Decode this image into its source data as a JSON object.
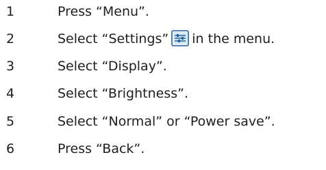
{
  "steps": [
    {
      "number": "1",
      "text": "Press “Menu”."
    },
    {
      "number": "2",
      "text_before": "Select “Settings”",
      "icon": "settings-icon",
      "text_after": "in the menu."
    },
    {
      "number": "3",
      "text": "Select “Display”."
    },
    {
      "number": "4",
      "text": "Select “Brightness”."
    },
    {
      "number": "5",
      "text": "Select “Normal” or “Power save”."
    },
    {
      "number": "6",
      "text": "Press “Back”."
    }
  ],
  "colors": {
    "text": "#1e1e1e",
    "icon_frame": "#1f5fa8",
    "icon_fill": "#d7e8f7"
  }
}
